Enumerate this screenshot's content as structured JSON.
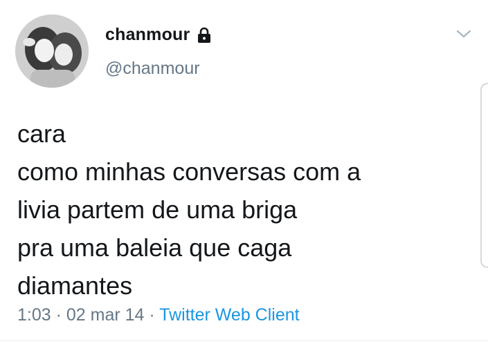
{
  "user": {
    "display_name": "chanmour",
    "handle": "@chanmour",
    "protected_icon": "lock-icon",
    "avatar_icon": "avatar"
  },
  "menu": {
    "caret_icon": "chevron-down-icon"
  },
  "tweet": {
    "lines": [
      "cara",
      "como minhas conversas com a",
      "livia partem de uma briga",
      "pra uma baleia que caga",
      "diamantes"
    ]
  },
  "meta": {
    "time": "1:03",
    "separator1": " · ",
    "date": "02 mar 14",
    "separator2": " · ",
    "source": "Twitter Web Client"
  },
  "colors": {
    "text": "#14171a",
    "secondary": "#657786",
    "link": "#1b95e0"
  }
}
